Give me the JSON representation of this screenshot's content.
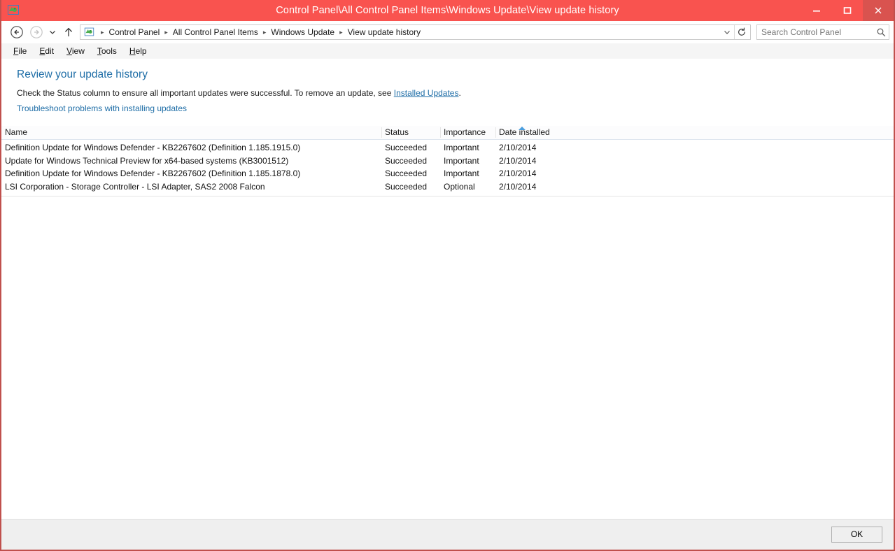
{
  "window": {
    "title": "Control Panel\\All Control Panel Items\\Windows Update\\View update history",
    "icon": "control-panel-icon",
    "controls": {
      "minimize": "—",
      "maximize": "☐",
      "close": "✕"
    },
    "colors": {
      "titlebar": "#f9534f",
      "border": "#c0504d",
      "close_hover": "#d9534f",
      "link": "#1f6ea7",
      "heading": "#1f6ea7",
      "footer": "#efefef"
    }
  },
  "navbar": {
    "back_icon": "back-arrow-icon",
    "forward_icon": "forward-arrow-icon",
    "recent_icon": "chevron-down-icon",
    "up_icon": "up-arrow-icon",
    "address_icon": "control-panel-icon",
    "breadcrumbs": [
      "Control Panel",
      "All Control Panel Items",
      "Windows Update",
      "View update history"
    ],
    "separator": "▸",
    "dropdown_icon": "chevron-down-icon",
    "refresh_icon": "refresh-icon"
  },
  "search": {
    "placeholder": "Search Control Panel",
    "value": "",
    "icon": "search-icon"
  },
  "menubar": {
    "items": [
      {
        "accel": "F",
        "rest": "ile"
      },
      {
        "accel": "E",
        "rest": "dit"
      },
      {
        "accel": "V",
        "rest": "iew"
      },
      {
        "accel": "T",
        "rest": "ools"
      },
      {
        "accel": "H",
        "rest": "elp"
      }
    ]
  },
  "main": {
    "title": "Review your update history",
    "subtitle_part1": "Check the Status column to ensure all important updates were successful. To remove an update, see ",
    "subtitle_link": "Installed Updates",
    "subtitle_part2": ".",
    "troubleshoot_link": "Troubleshoot problems with installing updates"
  },
  "table": {
    "columns": [
      "Name",
      "Status",
      "Importance",
      "Date installed"
    ],
    "sort_column": "Date installed",
    "sort_direction": "ascending",
    "rows": [
      {
        "name": "Definition Update for Windows Defender - KB2267602 (Definition 1.185.1915.0)",
        "status": "Succeeded",
        "importance": "Important",
        "date": "2/10/2014"
      },
      {
        "name": "Update for Windows Technical Preview for x64-based systems (KB3001512)",
        "status": "Succeeded",
        "importance": "Important",
        "date": "2/10/2014"
      },
      {
        "name": "Definition Update for Windows Defender - KB2267602 (Definition 1.185.1878.0)",
        "status": "Succeeded",
        "importance": "Important",
        "date": "2/10/2014"
      },
      {
        "name": "LSI Corporation - Storage Controller - LSI Adapter, SAS2 2008 Falcon",
        "status": "Succeeded",
        "importance": "Optional",
        "date": "2/10/2014"
      }
    ]
  },
  "footer": {
    "ok_label": "OK"
  }
}
